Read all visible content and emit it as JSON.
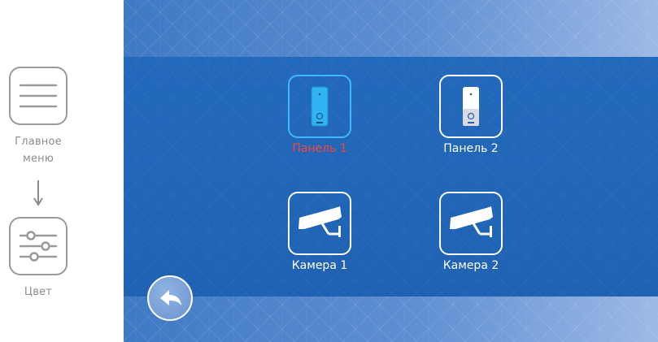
{
  "guide": {
    "main_menu_label_line1": "Главное",
    "main_menu_label_line2": "меню",
    "color_label": "Цвет",
    "main_menu_icon": "hamburger-menu-icon",
    "color_icon": "sliders-icon",
    "arrow_icon": "arrow-down-icon"
  },
  "screen": {
    "items": [
      {
        "label": "Панель 1",
        "icon": "door-panel-icon",
        "selected": true
      },
      {
        "label": "Панель 2",
        "icon": "door-panel-icon",
        "selected": false
      },
      {
        "label": "Камера 1",
        "icon": "cctv-camera-icon",
        "selected": false
      },
      {
        "label": "Камера 2",
        "icon": "cctv-camera-icon",
        "selected": false
      }
    ],
    "back_icon": "back-arrow-icon"
  },
  "colors": {
    "screen_blue": "#2367b8",
    "band_light": "#8fb0e0",
    "selected_border": "#3fb7ff",
    "selected_label": "#ff4436",
    "guide_gray": "#9a9a9a"
  }
}
